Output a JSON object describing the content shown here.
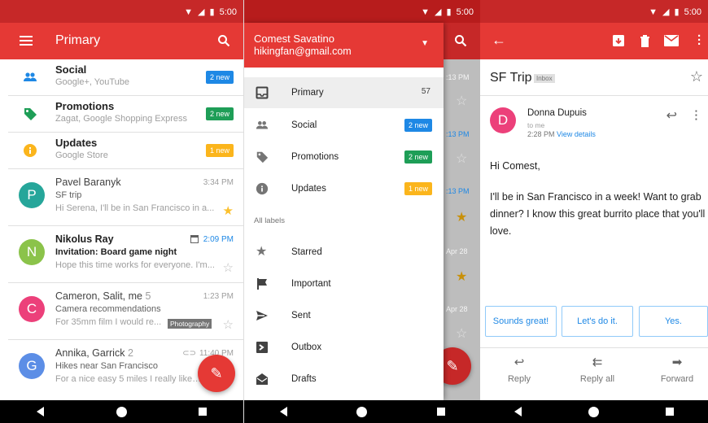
{
  "status": {
    "time": "5:00"
  },
  "list": {
    "title": "Primary",
    "categories": [
      {
        "title": "Social",
        "sub": "Google+, YouTube",
        "badge": "2 new",
        "color": "#1e88e5",
        "icon": "people-icon"
      },
      {
        "title": "Promotions",
        "sub": "Zagat, Google Shopping Express",
        "badge": "2 new",
        "color": "#1e9e57",
        "icon": "tag-icon"
      },
      {
        "title": "Updates",
        "sub": "Google Store",
        "badge": "1 new",
        "color": "#fbb51c",
        "icon": "info-icon"
      }
    ],
    "mails": [
      {
        "initial": "P",
        "color": "#26a69a",
        "from": "Pavel Baranyk",
        "count": "",
        "subject": "SF trip",
        "preview": "Hi Serena, I'll be in San Francisco in a...",
        "time": "3:34 PM",
        "starred": true,
        "bold": false
      },
      {
        "initial": "N",
        "color": "#8bc34a",
        "from": "Nikolus Ray",
        "count": "",
        "subject": "Invitation: Board game night",
        "preview": "Hope this time works for everyone. I'm...",
        "time": "2:09 PM",
        "starred": false,
        "bold": true
      },
      {
        "initial": "C",
        "color": "#ec407a",
        "from": "Cameron, Salit, me",
        "count": "5",
        "subject": "Camera recommendations",
        "preview": "For 35mm film I would re...",
        "time": "1:23 PM",
        "starred": false,
        "bold": false,
        "tag": "Photography"
      },
      {
        "initial": "G",
        "color": "#5c8ee6",
        "from": "Annika, Garrick",
        "count": "2",
        "subject": "Hikes near San Francisco",
        "preview": "For a nice easy 5 miles I really like th",
        "time": "11:40 PM",
        "starred": false,
        "bold": false
      }
    ]
  },
  "drawer": {
    "name": "Comest Savatino",
    "email": "hikingfan@gmail.com",
    "items": [
      {
        "label": "Primary",
        "count": "57",
        "icon": "inbox-icon",
        "selected": true
      },
      {
        "label": "Social",
        "badge": "2 new",
        "color": "#1e88e5",
        "icon": "people-icon"
      },
      {
        "label": "Promotions",
        "badge": "2 new",
        "color": "#1e9e57",
        "icon": "tag-icon"
      },
      {
        "label": "Updates",
        "badge": "1 new",
        "color": "#fbb51c",
        "icon": "info-icon"
      }
    ],
    "all_labels": "All labels",
    "labels": [
      {
        "label": "Starred",
        "icon": "star-icon"
      },
      {
        "label": "Important",
        "icon": "flag-icon"
      },
      {
        "label": "Sent",
        "icon": "send-icon"
      },
      {
        "label": "Outbox",
        "icon": "outbox-icon"
      },
      {
        "label": "Drafts",
        "icon": "drafts-icon"
      }
    ],
    "bg_times": [
      ":13 PM",
      ":13 PM",
      ":13 PM",
      "Apr 28",
      "Apr 28"
    ]
  },
  "detail": {
    "subject": "SF Trip",
    "label": "Inbox",
    "sender": "Donna Dupuis",
    "initial": "D",
    "color": "#ec407a",
    "to": "to me",
    "time": "2:28 PM",
    "details": "View details",
    "greeting": "Hi Comest,",
    "body": "I'll be in San Francisco in a week! Want to grab dinner? I know this great burrito place that you'll love.",
    "smart_replies": [
      "Sounds great!",
      "Let's do it.",
      "Yes."
    ],
    "actions": [
      "Reply",
      "Reply all",
      "Forward"
    ]
  }
}
